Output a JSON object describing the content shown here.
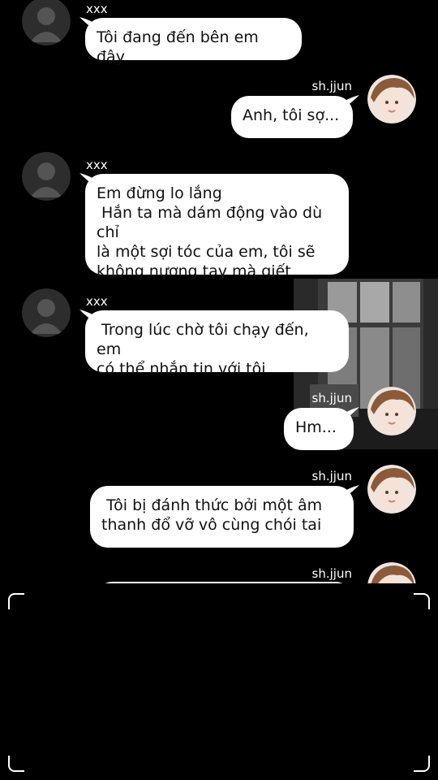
{
  "contacts": {
    "other_name": "xxx",
    "self_name": "sh.jjun"
  },
  "messages": [
    {
      "sender": "xxx",
      "text": "Tôi đang đến bên em đây"
    },
    {
      "sender": "sh.jjun",
      "text": "Anh, tôi sợ..."
    },
    {
      "sender": "xxx",
      "text": "Em đừng lo lắng\n Hắn ta mà dám động vào dù chỉ\nlà một sợi tóc của em, tôi sẽ\nkhông nương tay mà giết"
    },
    {
      "sender": "xxx",
      "text": " Trong lúc chờ tôi chạy đến, em\ncó thể nhắn tin với tôi"
    },
    {
      "sender": "sh.jjun",
      "text": "Hm..."
    },
    {
      "sender": "sh.jjun",
      "text": " Tôi bị đánh thức bởi một âm\nthanh đổ vỡ vô cùng chói tai"
    },
    {
      "sender": "sh.jjun",
      "text": ""
    }
  ],
  "colors": {
    "background": "#000000",
    "bubble": "#ffffff",
    "text": "#111111"
  }
}
